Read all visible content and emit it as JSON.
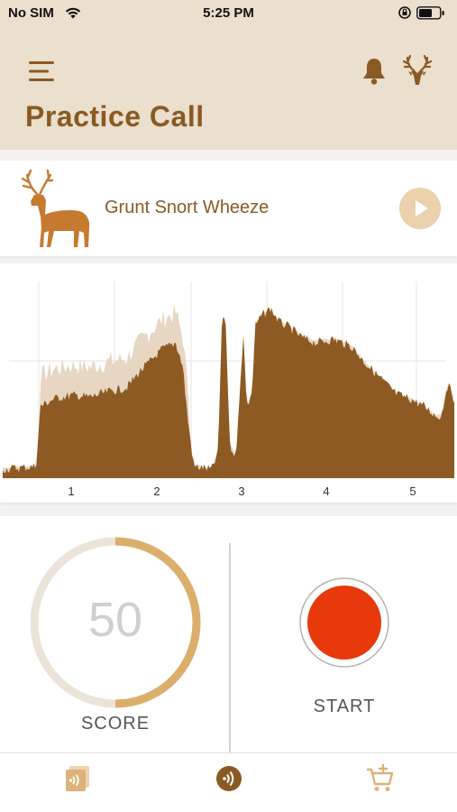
{
  "status_bar": {
    "carrier": "No SIM",
    "time": "5:25 PM"
  },
  "header": {
    "title": "Practice Call"
  },
  "call": {
    "name": "Grunt Snort Wheeze"
  },
  "waveform": {
    "x_ticks": [
      "1",
      "2",
      "3",
      "4",
      "5"
    ]
  },
  "score": {
    "value": "50",
    "label": "SCORE",
    "progress": 0.5
  },
  "record": {
    "label": "START"
  },
  "colors": {
    "brand_brown": "#8a5a24",
    "wave_fill": "#8c5a22",
    "header_bg": "#ebdfcd",
    "ring_track": "#ece4d8",
    "ring_progress": "#dcae6b",
    "record_red": "#e8390d"
  },
  "icons": {
    "menu": "hamburger-menu-icon",
    "bell": "bell-icon",
    "brand": "deer-head-logo-icon",
    "play": "play-icon",
    "tab_library": "library-audio-icon",
    "tab_practice": "practice-call-icon",
    "tab_store": "cart-add-icon"
  }
}
